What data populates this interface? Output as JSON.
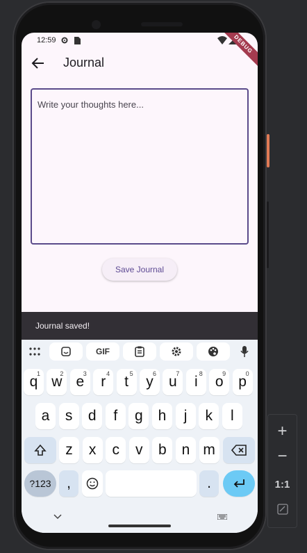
{
  "status_bar": {
    "time": "12:59"
  },
  "debug_banner": "DEBUG",
  "app_bar": {
    "title": "Journal"
  },
  "journal": {
    "placeholder": "Write your thoughts here...",
    "value": ""
  },
  "save_button": {
    "label": "Save Journal"
  },
  "snackbar": {
    "message": "Journal saved!"
  },
  "keyboard": {
    "toolbar": {
      "gif_label": "GIF"
    },
    "row1": [
      {
        "key": "q",
        "hint": "1"
      },
      {
        "key": "w",
        "hint": "2"
      },
      {
        "key": "e",
        "hint": "3"
      },
      {
        "key": "r",
        "hint": "4"
      },
      {
        "key": "t",
        "hint": "5"
      },
      {
        "key": "y",
        "hint": "6"
      },
      {
        "key": "u",
        "hint": "7"
      },
      {
        "key": "i",
        "hint": "8"
      },
      {
        "key": "o",
        "hint": "9"
      },
      {
        "key": "p",
        "hint": "0"
      }
    ],
    "row2": [
      "a",
      "s",
      "d",
      "f",
      "g",
      "h",
      "j",
      "k",
      "l"
    ],
    "row3": [
      "z",
      "x",
      "c",
      "v",
      "b",
      "n",
      "m"
    ],
    "row4": {
      "symbols": "?123",
      "comma": ",",
      "period": "."
    }
  },
  "emulator_controls": {
    "ratio_label": "1:1"
  },
  "colors": {
    "accent": "#5a4a8a",
    "enter_key": "#6ccaf5",
    "snackbar": "#322f35"
  }
}
